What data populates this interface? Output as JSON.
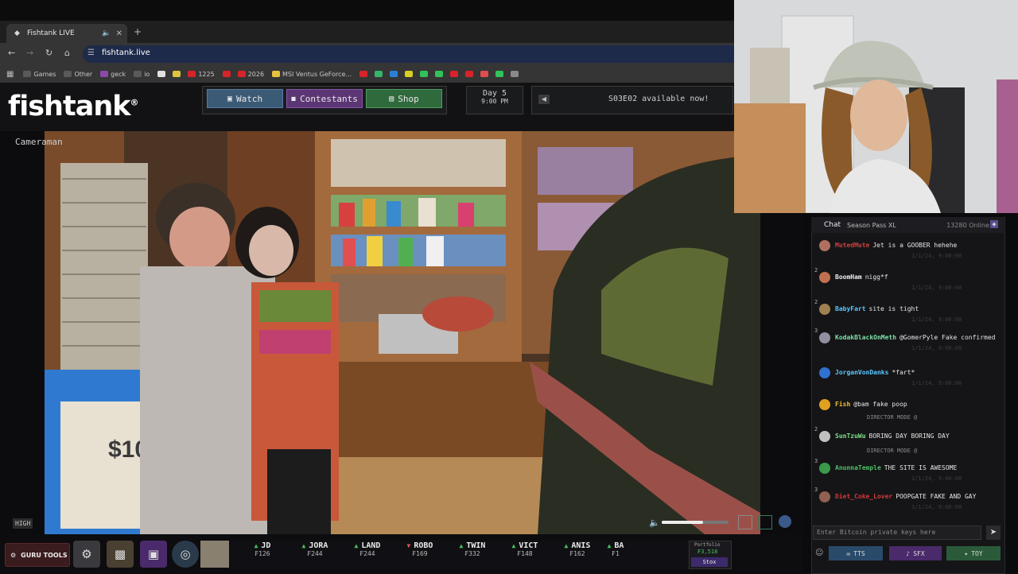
{
  "browser": {
    "tab_title": "Fishtank LIVE",
    "new_tab": "+",
    "url": "fishtank.live",
    "bookmarks": [
      {
        "label": "Games",
        "color": "#5a5a5a"
      },
      {
        "label": "Other",
        "color": "#5a5a5a"
      },
      {
        "label": "geck",
        "color": "#8b4aa8"
      },
      {
        "label": "io",
        "color": "#5a5a5a"
      },
      {
        "label": "",
        "color": "#e0e0e0"
      },
      {
        "label": "",
        "color": "#e0c040"
      },
      {
        "label": "1225",
        "color": "#d8232a"
      },
      {
        "label": "",
        "color": "#d8232a"
      },
      {
        "label": "2026",
        "color": "#d8232a"
      },
      {
        "label": "MSI Ventus GeForce...",
        "color": "#e8c240"
      },
      {
        "label": "",
        "color": "#d8232a"
      },
      {
        "label": "",
        "color": "#33b56b"
      },
      {
        "label": "",
        "color": "#2a7fd8"
      },
      {
        "label": "",
        "color": "#d8d020"
      },
      {
        "label": "",
        "color": "#31c25a"
      },
      {
        "label": "",
        "color": "#31c25a"
      },
      {
        "label": "",
        "color": "#d8232a"
      },
      {
        "label": "",
        "color": "#d8232a"
      },
      {
        "label": "",
        "color": "#e04c4c"
      },
      {
        "label": "",
        "color": "#31c25a"
      },
      {
        "label": "",
        "color": "#8a8a8a"
      }
    ]
  },
  "site": {
    "logo": "fishtank",
    "logo_mark": "®",
    "nav": {
      "watch": "Watch",
      "contestants": "Contestants",
      "shop": "Shop"
    },
    "day": "Day 5",
    "time": "9:00 PM",
    "announcement": "S03E02 available now!"
  },
  "player": {
    "camera_label": "Cameraman",
    "quality": "HIGH",
    "volume": 0.62
  },
  "chat": {
    "title": "Chat",
    "pass": "Season Pass XL",
    "online": "13280 Online",
    "input_placeholder": "Enter Bitcoin private keys here",
    "send": "➤",
    "buttons": {
      "tts": "TTS",
      "sfx": "SFX",
      "toy": "TOY"
    },
    "messages": [
      {
        "level": "",
        "user": "MutedMute",
        "user_color": "#d04040",
        "avatar": "#b07060",
        "text": "Jet is a GOOBER hehehe",
        "ts": "1/1/24, 9:00:00"
      },
      {
        "level": "2",
        "user": "BoomHam",
        "user_color": "#f0f0f0",
        "avatar": "#c07050",
        "text": "nigg*f",
        "ts": "1/1/24, 9:00:00"
      },
      {
        "level": "2",
        "user": "BabyFart",
        "user_color": "#5cc7ff",
        "avatar": "#a08050",
        "text": "site is tight",
        "ts": "1/1/24, 9:00:00"
      },
      {
        "level": "3",
        "user": "KodakBlackOnMeth",
        "user_color": "#7de0a8",
        "avatar": "#9090a0",
        "text": "@GomerPyle Fake confirmed",
        "ts": "1/1/24, 9:00:00"
      },
      {
        "level": "",
        "user": "JorganVonDanks",
        "user_color": "#5cc7ff",
        "avatar": "#3070d0",
        "text": "*fart*",
        "ts": "1/1/24, 9:00:00"
      },
      {
        "level": "",
        "user": "Fish",
        "user_color": "#f0c030",
        "avatar": "#e0a020",
        "text": "@bam fake poop",
        "ts": ""
      },
      {
        "level": "2",
        "user": "SunTzuWu",
        "user_color": "#7de08a",
        "avatar": "#c0c0c0",
        "text": "BORING DAY BORING DAY",
        "ts": ""
      },
      {
        "level": "3",
        "user": "AnunnaTemple",
        "user_color": "#4fbf6a",
        "avatar": "#3a9a4a",
        "text": "THE SITE IS AWESOME",
        "ts": "1/1/24, 9:00:00"
      },
      {
        "level": "3",
        "user": "Diet_Coke_Lover",
        "user_color": "#d03a3a",
        "avatar": "#906050",
        "text": "POOPGATE FAKE AND GAY",
        "ts": "1/1/24, 9:00:00"
      }
    ],
    "system": [
      "DIRECTOR MODE @",
      "DIRECTOR MODE @"
    ]
  },
  "bottom": {
    "guru": "GURU TOOLS",
    "tickers": [
      {
        "name": "JD",
        "dir": "up",
        "price": "₣126"
      },
      {
        "name": "JORA",
        "dir": "up",
        "price": "₣244"
      },
      {
        "name": "LAND",
        "dir": "up",
        "price": "₣244"
      },
      {
        "name": "ROBO",
        "dir": "down",
        "price": "₣169"
      },
      {
        "name": "TWIN",
        "dir": "up",
        "price": "₣332"
      },
      {
        "name": "VICT",
        "dir": "up",
        "price": "₣148"
      },
      {
        "name": "ANIS",
        "dir": "up",
        "price": "₣162"
      },
      {
        "name": "BA",
        "dir": "up",
        "price": "₣1"
      }
    ],
    "portfolio_label": "Portfolio",
    "portfolio_value": "₣3,518",
    "stox": "Stox"
  }
}
